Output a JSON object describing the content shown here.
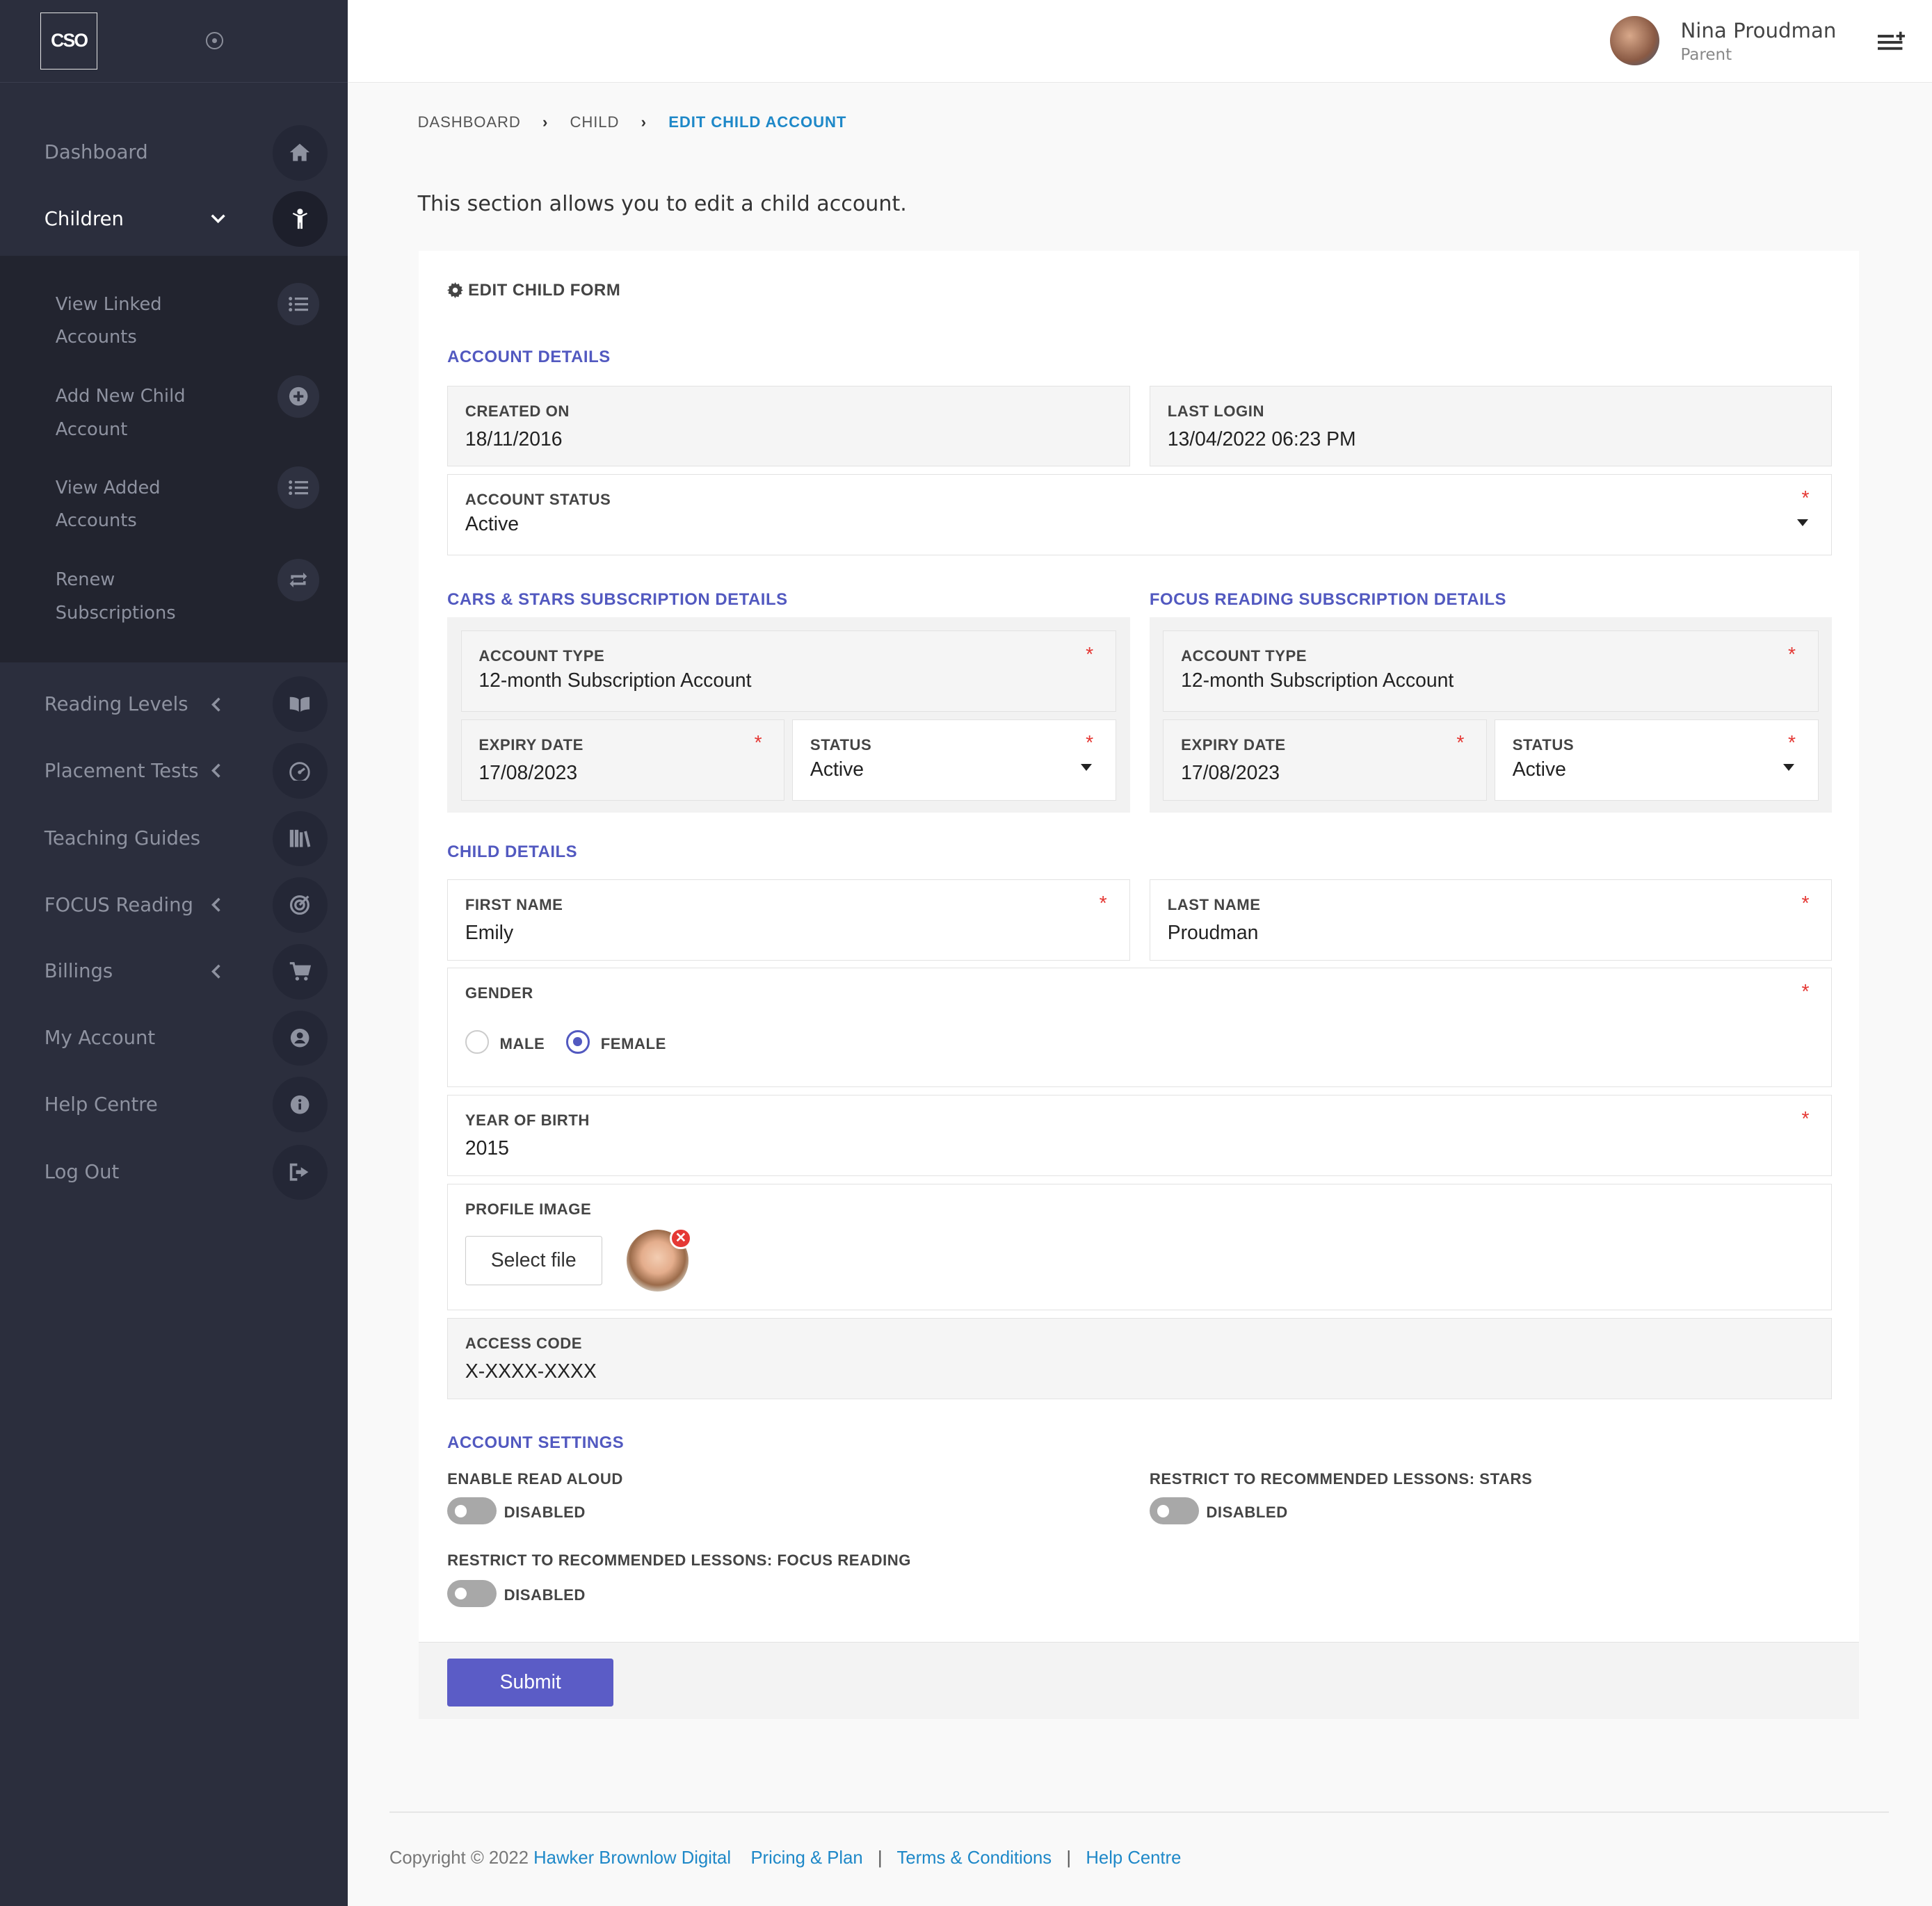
{
  "brand": {
    "logo_text": "CSO"
  },
  "sidebar": {
    "items": [
      {
        "label": "Dashboard",
        "icon": "home-icon"
      },
      {
        "label": "Children",
        "icon": "child-icon",
        "chevron": "down"
      },
      {
        "label": "Reading Levels",
        "icon": "book-open-icon",
        "chevron": "left"
      },
      {
        "label": "Placement Tests",
        "icon": "gauge-icon",
        "chevron": "left"
      },
      {
        "label": "Teaching Guides",
        "icon": "library-icon"
      },
      {
        "label": "FOCUS Reading",
        "icon": "target-icon",
        "chevron": "left"
      },
      {
        "label": "Billings",
        "icon": "cart-icon",
        "chevron": "left"
      },
      {
        "label": "My Account",
        "icon": "user-circle-icon"
      },
      {
        "label": "Help Centre",
        "icon": "info-icon"
      },
      {
        "label": "Log Out",
        "icon": "logout-icon"
      }
    ],
    "submenu": [
      {
        "label": "View Linked Accounts",
        "icon": "list-icon"
      },
      {
        "label": "Add New Child Account",
        "icon": "plus-circle-icon"
      },
      {
        "label": "View Added Accounts",
        "icon": "list-icon"
      },
      {
        "label": "Renew Subscriptions",
        "icon": "repeat-icon"
      }
    ]
  },
  "header": {
    "user_name": "Nina Proudman",
    "user_role": "Parent",
    "menu_icon": "menu-add-icon"
  },
  "breadcrumb": [
    "DASHBOARD",
    "CHILD",
    "EDIT CHILD ACCOUNT"
  ],
  "intro": "This section allows you to edit a child account.",
  "form": {
    "title": "EDIT CHILD FORM",
    "account_details": {
      "heading": "ACCOUNT DETAILS",
      "created_on": {
        "label": "CREATED ON",
        "value": "18/11/2016"
      },
      "last_login": {
        "label": "LAST LOGIN",
        "value": "13/04/2022 06:23 PM"
      },
      "status": {
        "label": "ACCOUNT STATUS",
        "value": "Active"
      }
    },
    "cars_stars": {
      "heading": "CARS & STARS SUBSCRIPTION DETAILS",
      "account_type": {
        "label": "ACCOUNT TYPE",
        "value": "12-month Subscription Account"
      },
      "expiry": {
        "label": "EXPIRY DATE",
        "value": "17/08/2023"
      },
      "status": {
        "label": "STATUS",
        "value": "Active"
      }
    },
    "focus_reading": {
      "heading": "FOCUS READING SUBSCRIPTION DETAILS",
      "account_type": {
        "label": "ACCOUNT TYPE",
        "value": "12-month Subscription Account"
      },
      "expiry": {
        "label": "EXPIRY DATE",
        "value": "17/08/2023"
      },
      "status": {
        "label": "STATUS",
        "value": "Active"
      }
    },
    "child_details": {
      "heading": "CHILD DETAILS",
      "first_name": {
        "label": "FIRST NAME",
        "value": "Emily"
      },
      "last_name": {
        "label": "LAST NAME",
        "value": "Proudman"
      },
      "gender": {
        "label": "GENDER",
        "options": [
          "MALE",
          "FEMALE"
        ],
        "selected": "FEMALE"
      },
      "year_of_birth": {
        "label": "YEAR OF BIRTH",
        "value": "2015"
      },
      "profile_image": {
        "label": "PROFILE IMAGE",
        "button": "Select file"
      },
      "access_code": {
        "label": "ACCESS CODE",
        "value": "X-XXXX-XXXX"
      }
    },
    "account_settings": {
      "heading": "ACCOUNT SETTINGS",
      "read_aloud": {
        "label": "ENABLE READ ALOUD",
        "state": "DISABLED"
      },
      "restrict_stars": {
        "label": "RESTRICT TO RECOMMENDED LESSONS: STARS",
        "state": "DISABLED"
      },
      "restrict_focus": {
        "label": "RESTRICT TO RECOMMENDED LESSONS: FOCUS READING",
        "state": "DISABLED"
      }
    },
    "required_mark": "*",
    "submit": "Submit"
  },
  "footer": {
    "copyright": "Copyright © 2022",
    "company": "Hawker Brownlow Digital",
    "links": [
      "Pricing & Plan",
      "Terms & Conditions",
      "Help Centre"
    ],
    "separator": "|"
  }
}
